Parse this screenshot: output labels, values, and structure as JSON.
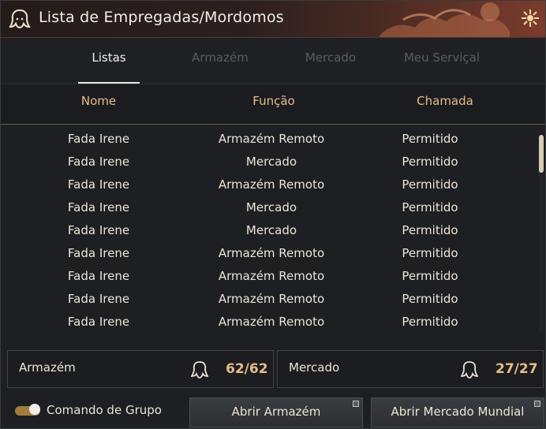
{
  "window": {
    "title": "Lista de Empregadas/Mordomos"
  },
  "tabs": [
    {
      "label": "Listas",
      "active": true
    },
    {
      "label": "Armazém",
      "active": false
    },
    {
      "label": "Mercado",
      "active": false
    },
    {
      "label": "Meu Serviçal",
      "active": false
    }
  ],
  "table": {
    "headers": {
      "name": "Nome",
      "function": "Função",
      "call": "Chamada"
    },
    "rows": [
      {
        "name": "Fada Irene",
        "function": "Armazém Remoto",
        "call": "Permitido"
      },
      {
        "name": "Fada Irene",
        "function": "Mercado",
        "call": "Permitido"
      },
      {
        "name": "Fada Irene",
        "function": "Armazém Remoto",
        "call": "Permitido"
      },
      {
        "name": "Fada Irene",
        "function": "Mercado",
        "call": "Permitido"
      },
      {
        "name": "Fada Irene",
        "function": "Mercado",
        "call": "Permitido"
      },
      {
        "name": "Fada Irene",
        "function": "Armazém Remoto",
        "call": "Permitido"
      },
      {
        "name": "Fada Irene",
        "function": "Armazém Remoto",
        "call": "Permitido"
      },
      {
        "name": "Fada Irene",
        "function": "Armazém Remoto",
        "call": "Permitido"
      },
      {
        "name": "Fada Irene",
        "function": "Armazém Remoto",
        "call": "Permitido"
      }
    ]
  },
  "counters": {
    "warehouse": {
      "label": "Armazém",
      "value": "62/62"
    },
    "market": {
      "label": "Mercado",
      "value": "27/27"
    }
  },
  "footer": {
    "group_command_label": "Comando de Grupo",
    "group_command_on": true,
    "open_warehouse_label": "Abrir Armazém",
    "open_market_label": "Abrir Mercado Mundial"
  },
  "colors": {
    "accent": "#e7bd86",
    "text": "#efe5d3",
    "background": "#1d1f23"
  },
  "icons": {
    "title": "maid-icon",
    "corner": "emblem-icon",
    "counter": "maid-icon"
  }
}
